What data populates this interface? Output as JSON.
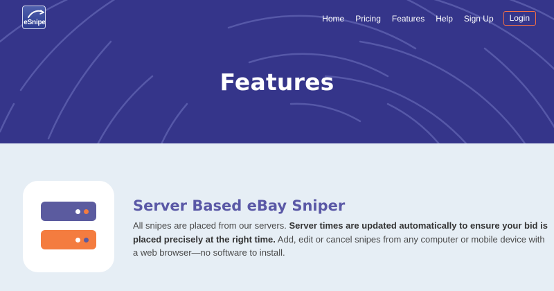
{
  "brand": {
    "logo_text": "eSnipe"
  },
  "nav": {
    "items": [
      "Home",
      "Pricing",
      "Features",
      "Help",
      "Sign Up"
    ],
    "login": "Login"
  },
  "hero": {
    "title": "Features"
  },
  "colors": {
    "hero_bg": "#35358a",
    "accent_orange": "#f47c3f",
    "accent_purple": "#5a58a6",
    "page_bg": "#e6eef5"
  },
  "feature": {
    "icon": "server-icon",
    "title": "Server Based eBay Sniper",
    "text_part1": "All snipes are placed from our servers. ",
    "text_bold": "Server times are updated automatically to ensure your bid is placed precisely at the right time.",
    "text_part2": " Add, edit or cancel snipes from any computer or mobile device with a web browser—no software to install."
  }
}
